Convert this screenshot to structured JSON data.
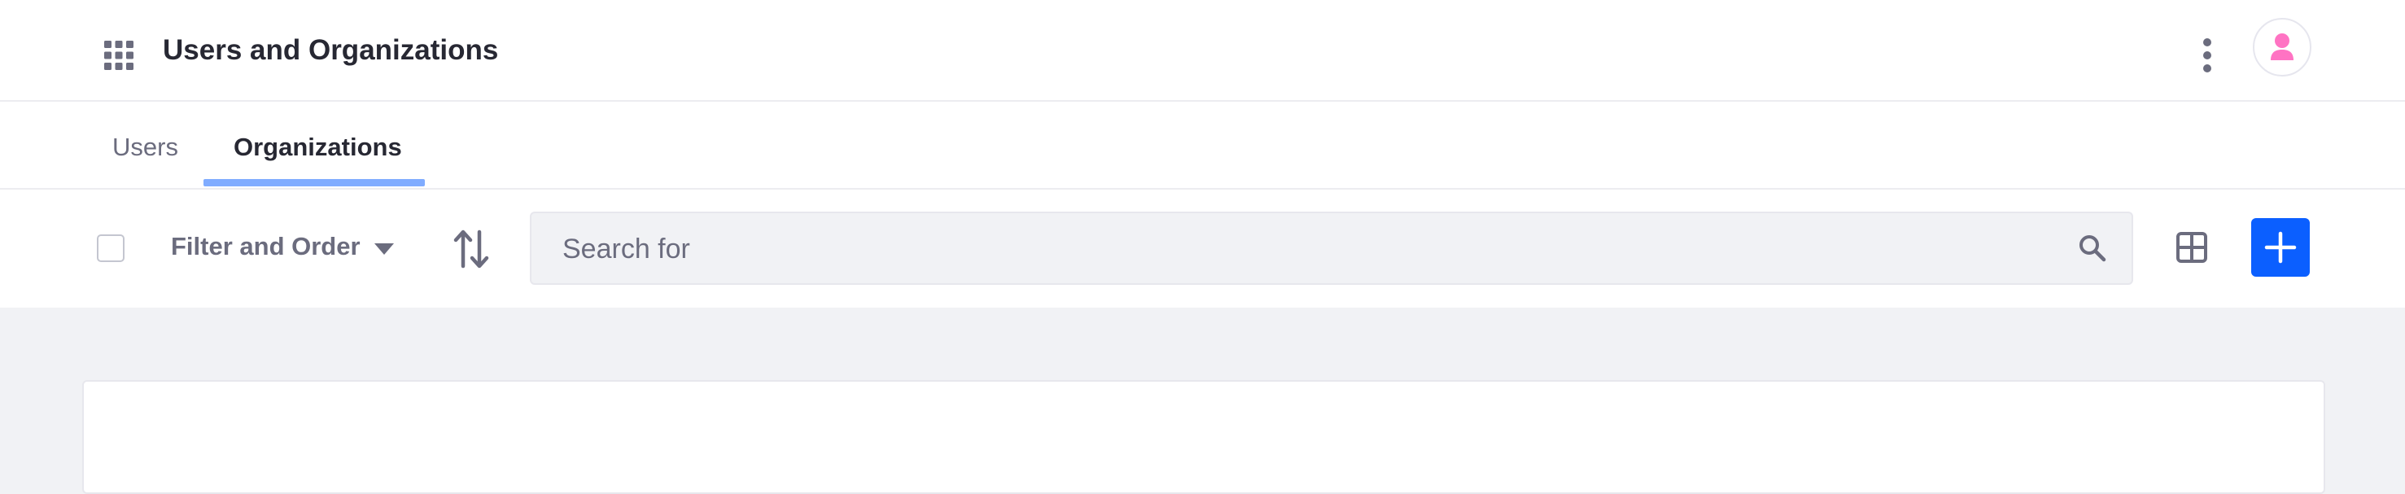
{
  "header": {
    "title": "Users and Organizations",
    "apps_icon": "apps-grid-icon",
    "options_icon": "vertical-ellipsis-icon",
    "avatar_icon": "user-icon",
    "avatar_color": "#ff73c3"
  },
  "tabs": [
    {
      "label": "Users",
      "active": false
    },
    {
      "label": "Organizations",
      "active": true
    }
  ],
  "toolbar": {
    "filter_label": "Filter and Order",
    "search": {
      "placeholder": "Search for",
      "value": ""
    },
    "primary_color": "#0b5fff"
  }
}
